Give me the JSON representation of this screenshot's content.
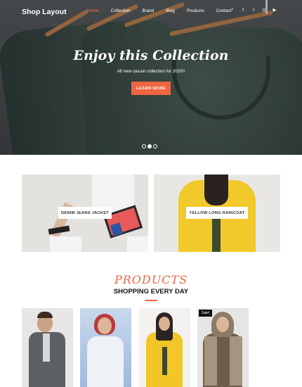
{
  "nav": {
    "brand": "Shop Layout",
    "items": [
      {
        "label": "Home",
        "active": true
      },
      {
        "label": "Collection"
      },
      {
        "label": "Brand"
      },
      {
        "label": "Blog"
      },
      {
        "label": "Products"
      },
      {
        "label": "Contact"
      }
    ],
    "icons": [
      "search-icon",
      "facebook-icon",
      "twitter-icon",
      "instagram-icon",
      "youtube-icon"
    ],
    "icon_glyphs": {
      "search": "⌕",
      "facebook": "f",
      "twitter": "t",
      "instagram": "◎",
      "youtube": "▶"
    }
  },
  "hero": {
    "title": "Enjoy this Collection",
    "subtitle": "All new casual collection for 2020!!",
    "button": "LEARN MORE",
    "slides": 3,
    "active_slide": 2
  },
  "categories": [
    {
      "label": "DENIM JEANS JACKET"
    },
    {
      "label": "YELLOW LONG RAINCOAT"
    }
  ],
  "products": {
    "title": "PRODUCTS",
    "subtitle": "SHOPPING EVERY DAY",
    "items": [
      {
        "badge": ""
      },
      {
        "badge": ""
      },
      {
        "badge": ""
      },
      {
        "badge": "Sale!"
      }
    ]
  },
  "colors": {
    "accent": "#f06542",
    "hero_overlay": "#4a4f51",
    "text_dark": "#111111"
  }
}
